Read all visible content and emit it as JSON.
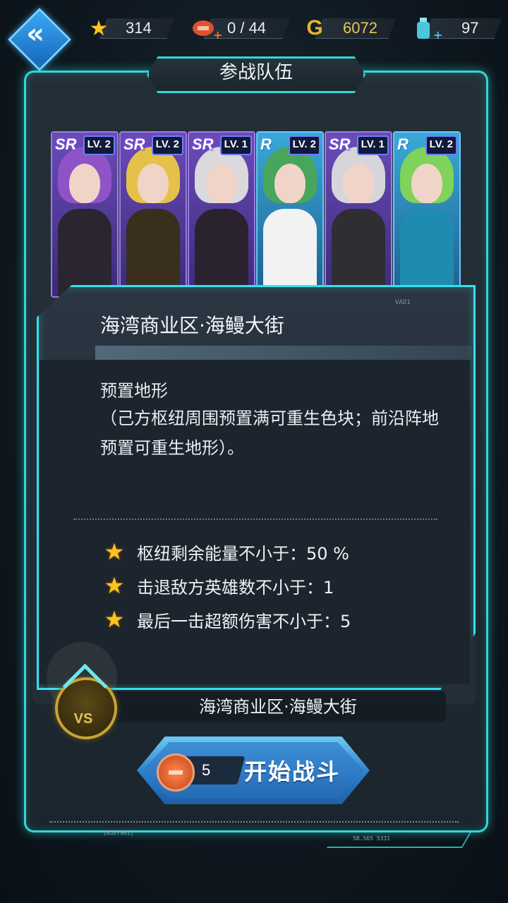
{
  "top": {
    "stars": "314",
    "energy": "0 / 44",
    "gold_letter": "G",
    "gold": "6072",
    "potion": "97",
    "plus": "+"
  },
  "header": {
    "title": "参战队伍"
  },
  "team": [
    {
      "rarity": "SR",
      "level": "LV. 2",
      "hair": "#8e54c7",
      "body": "#2a2530"
    },
    {
      "rarity": "SR",
      "level": "LV. 2",
      "hair": "#e6c14a",
      "body": "#3a2e1c"
    },
    {
      "rarity": "SR",
      "level": "LV. 1",
      "hair": "#d9d9de",
      "body": "#2b2230"
    },
    {
      "rarity": "R",
      "level": "LV. 2",
      "hair": "#48a55c",
      "body": "#f2f2f2"
    },
    {
      "rarity": "SR",
      "level": "LV. 1",
      "hair": "#d6d6da",
      "body": "#2e2e34"
    },
    {
      "rarity": "R",
      "level": "LV. 2",
      "hair": "#7fd25a",
      "body": "#1e8bb0"
    }
  ],
  "stage": {
    "name": "海湾商业区·海鳗大街",
    "terrain_title": "预置地形",
    "terrain_desc": "（己方枢纽周围预置满可重生色块；前沿阵地预置可重生地形）。",
    "objectives": [
      "枢纽剩余能量不小于：50 %",
      "击退敌方英雄数不小于：1",
      "最后一击超额伤害不小于：5"
    ],
    "deco_label": "VAD1"
  },
  "bottom": {
    "stage_name": "海湾商业区·海鳗大街",
    "vs": "VS",
    "cost": "5",
    "start_label": "开始战斗",
    "deco_left": "[B52T9B1]",
    "deco_right": "5B.565  5331"
  },
  "colors": {
    "accent": "#2fd8d8",
    "star": "#ffc21f",
    "button": "#2a7fcb"
  }
}
